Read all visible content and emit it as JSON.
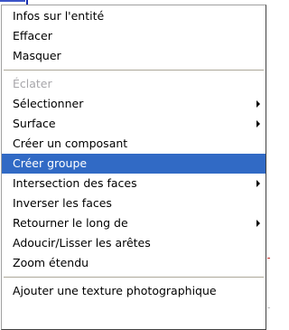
{
  "menu": {
    "items": [
      {
        "label": "Infos sur l'entité"
      },
      {
        "label": "Effacer"
      },
      {
        "label": "Masquer"
      },
      {
        "label": "Éclater"
      },
      {
        "label": "Sélectionner"
      },
      {
        "label": "Surface"
      },
      {
        "label": "Créer un composant"
      },
      {
        "label": "Créer groupe"
      },
      {
        "label": "Intersection des faces"
      },
      {
        "label": "Inverser les faces"
      },
      {
        "label": "Retourner le long de"
      },
      {
        "label": "Adoucir/Lisser les arêtes"
      },
      {
        "label": "Zoom étendu"
      },
      {
        "label": "Ajouter une texture photographique"
      }
    ],
    "selected_label": "Créer groupe",
    "disabled_labels": [
      "Éclater"
    ]
  },
  "colors": {
    "selection": "#316ac5",
    "disabled_text": "#a7a6aa",
    "separator": "#aca899"
  }
}
